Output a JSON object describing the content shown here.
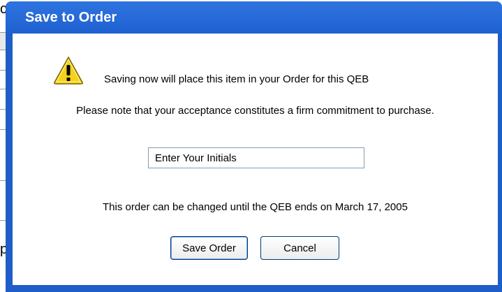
{
  "background": {
    "fragment_top": "c",
    "fragment_bottom": "p"
  },
  "dialog": {
    "title": "Save to Order",
    "icon": "warning-icon",
    "message": "Saving now will place this item in your Order for this QEB",
    "note": "Please note that your acceptance constitutes a firm commitment to purchase.",
    "initials_value": "Enter Your Initials",
    "deadline": "This order can be changed until the QEB ends on March 17, 2005",
    "save_label": "Save Order",
    "cancel_label": "Cancel"
  },
  "colors": {
    "title_bar": "#1f5dc9",
    "warning_fill": "#f5d21a"
  }
}
